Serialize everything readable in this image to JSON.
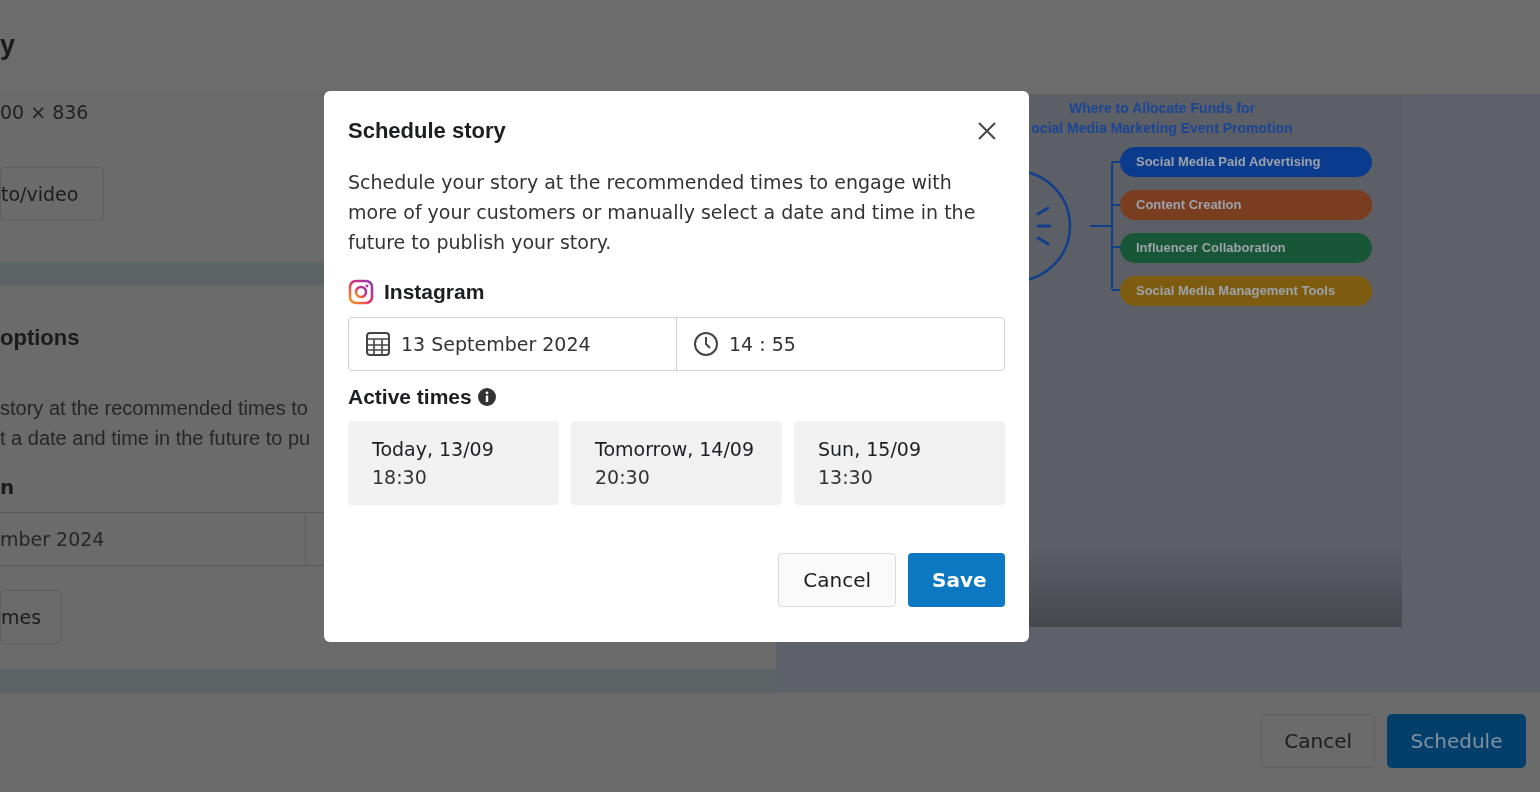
{
  "page": {
    "title": "y",
    "dimensions": "00 × 836",
    "upload_button": "to/video",
    "section_title": "options",
    "description_lines": [
      "story at the recommended times to",
      "t a date and time in the future to pu"
    ],
    "platform_label": "n",
    "date_value": "mber 2024",
    "active_times_button": "mes"
  },
  "preview": {
    "title_lines": [
      "Where to Allocate Funds for",
      "ocial Media Marketing Event Promotion"
    ],
    "branches": [
      {
        "label": "Social Media Paid Advertising",
        "color": "#0b3b8c"
      },
      {
        "label": "Content Creation",
        "color": "#7b3d1f"
      },
      {
        "label": "Influencer Collaboration",
        "color": "#175636"
      },
      {
        "label": "Social Media Management Tools",
        "color": "#7d5c0f"
      }
    ]
  },
  "footer": {
    "buttons": [
      {
        "label": "Cancel",
        "kind": "secondary"
      },
      {
        "label": "Schedule",
        "kind": "primary"
      }
    ]
  },
  "dialog": {
    "title": "Schedule story",
    "description": "Schedule your story at the recommended times to engage with more of your customers or manually select a date and time in the future to publish your story.",
    "platform": "Instagram",
    "date": "13 September 2024",
    "time": "14 : 55",
    "active_times_label": "Active times",
    "slots": [
      {
        "day": "Today, 13/09",
        "time": "18:30"
      },
      {
        "day": "Tomorrow, 14/09",
        "time": "20:30"
      },
      {
        "day": "Sun, 15/09",
        "time": "13:30"
      }
    ],
    "buttons": [
      {
        "label": "Cancel",
        "kind": "secondary"
      },
      {
        "label": "Save",
        "kind": "primary"
      }
    ]
  }
}
